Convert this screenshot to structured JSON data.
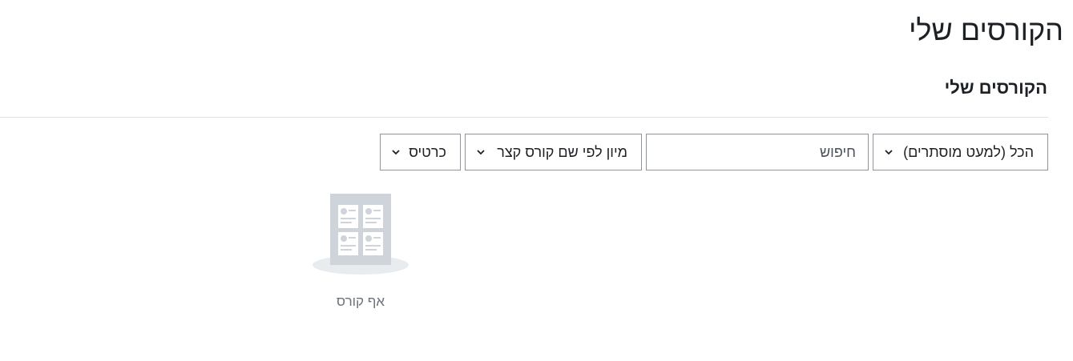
{
  "page": {
    "title": "הקורסים שלי"
  },
  "block": {
    "title": "הקורסים שלי"
  },
  "filters": {
    "grouping": "הכל (למעט מוסתרים)",
    "search_placeholder": "חיפוש",
    "search_value": "",
    "sort": "מיון לפי שם קורס קצר",
    "view": "כרטיס"
  },
  "empty_state": {
    "message": "אף קורס"
  },
  "colors": {
    "border": "#8f959e",
    "divider": "#dee2e6",
    "muted_text": "#6a737b",
    "illustration": "#ced4da"
  }
}
